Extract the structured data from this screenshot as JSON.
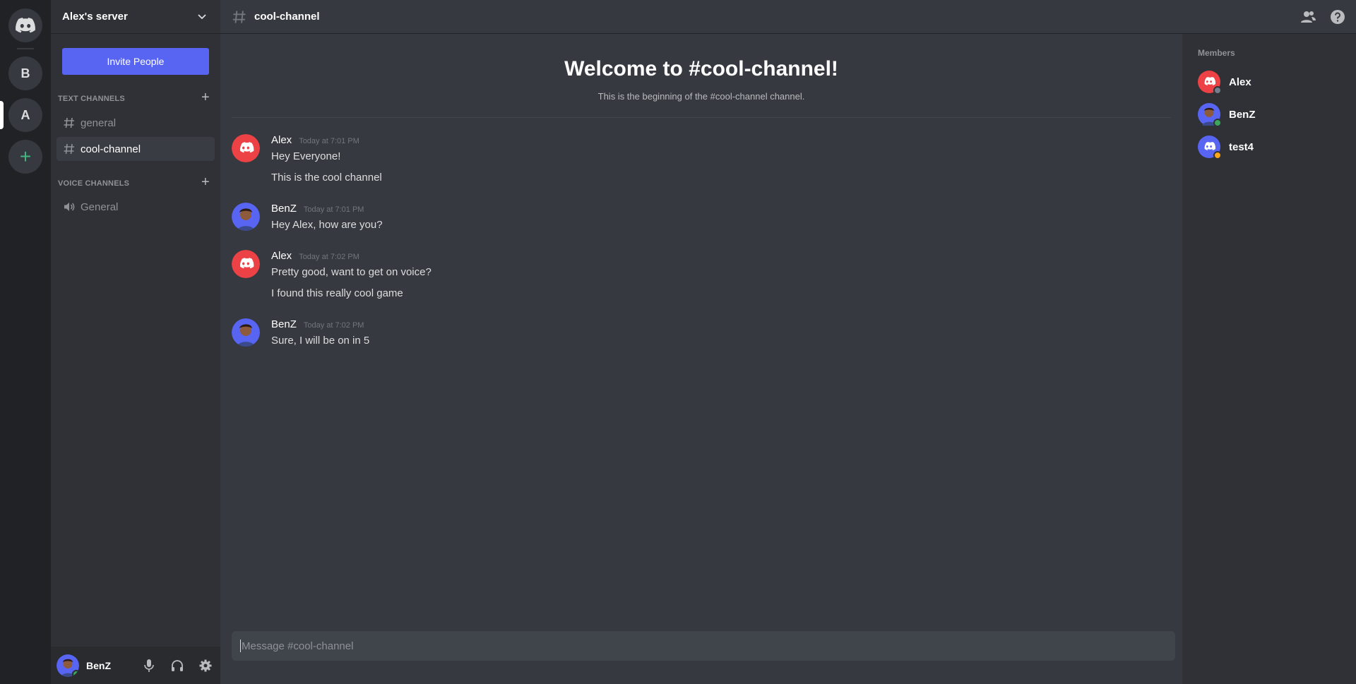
{
  "app": {
    "title": "Discord"
  },
  "rail": {
    "servers": [
      {
        "label": "B"
      },
      {
        "label": "A",
        "active": true
      }
    ],
    "add_label": "+"
  },
  "server": {
    "name": "Alex's server",
    "invite_label": "Invite People",
    "categories": {
      "text": "TEXT CHANNELS",
      "voice": "VOICE CHANNELS"
    },
    "text_channels": [
      {
        "name": "general",
        "active": false
      },
      {
        "name": "cool-channel",
        "active": true
      }
    ],
    "voice_channels": [
      {
        "name": "General"
      }
    ]
  },
  "user_panel": {
    "name": "BenZ",
    "status": "online"
  },
  "topbar": {
    "channel": "cool-channel"
  },
  "chat": {
    "welcome_title": "Welcome to #cool-channel!",
    "welcome_sub": "This is the beginning of the #cool-channel channel.",
    "messages": [
      {
        "author": "Alex",
        "time": "Today at 7:01 PM",
        "lines": [
          "Hey Everyone!",
          "This is the cool channel"
        ]
      },
      {
        "author": "BenZ",
        "time": "Today at 7:01 PM",
        "lines": [
          "Hey Alex, how are you?"
        ]
      },
      {
        "author": "Alex",
        "time": "Today at 7:02 PM",
        "lines": [
          "Pretty good, want to get on voice?",
          "I found this really cool game"
        ]
      },
      {
        "author": "BenZ",
        "time": "Today at 7:02 PM",
        "lines": [
          "Sure, I will be on in 5"
        ]
      }
    ],
    "composer_placeholder": "Message #cool-channel"
  },
  "members": {
    "title": "Members",
    "list": [
      {
        "name": "Alex",
        "status": "offline"
      },
      {
        "name": "BenZ",
        "status": "online"
      },
      {
        "name": "test4",
        "status": "idle"
      }
    ]
  },
  "colors": {
    "blurple": "#5865f2",
    "red_avatar": "#ed4245",
    "online": "#3ba55d",
    "idle": "#faa61a",
    "offline": "#747f8d"
  }
}
